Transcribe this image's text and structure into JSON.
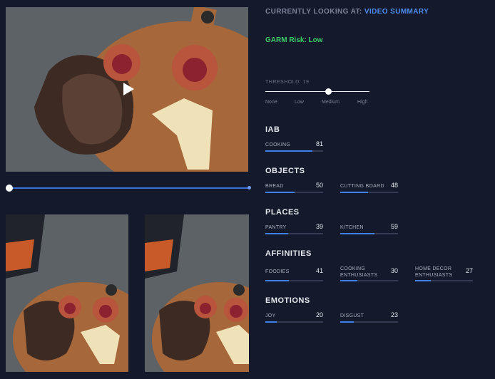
{
  "header": {
    "looking_prefix": "CURRENTLY LOOKING AT:",
    "looking_value": "VIDEO SUMMARY",
    "garm": "GARM Risk: Low"
  },
  "threshold": {
    "label": "THRESHOLD: 19",
    "options": [
      "None",
      "Low",
      "Medium",
      "High"
    ],
    "selected": "Medium"
  },
  "timeline": {
    "position": 0
  },
  "sections": {
    "iab": {
      "title": "IAB",
      "items": [
        {
          "label": "COOKING",
          "value": "81",
          "fraction": 0.81
        }
      ]
    },
    "objects": {
      "title": "OBJECTS",
      "items": [
        {
          "label": "BREAD",
          "value": "50",
          "fraction": 0.5
        },
        {
          "label": "CUTTING BOARD",
          "value": "48",
          "fraction": 0.48
        }
      ]
    },
    "places": {
      "title": "PLACES",
      "items": [
        {
          "label": "PANTRY",
          "value": "39",
          "fraction": 0.39
        },
        {
          "label": "KITCHEN",
          "value": "59",
          "fraction": 0.59
        }
      ]
    },
    "affinities": {
      "title": "AFFINITIES",
      "items": [
        {
          "label": "FOODIES",
          "value": "41",
          "fraction": 0.41
        },
        {
          "label": "COOKING ENTHUSIASTS",
          "value": "30",
          "fraction": 0.3
        },
        {
          "label": "HOME DECOR ENTHUSIASTS",
          "value": "27",
          "fraction": 0.27
        }
      ]
    },
    "emotions": {
      "title": "EMOTIONS",
      "items": [
        {
          "label": "JOY",
          "value": "20",
          "fraction": 0.2
        },
        {
          "label": "DISGUST",
          "value": "23",
          "fraction": 0.23
        }
      ]
    }
  },
  "colors": {
    "background": "#141a2b",
    "accent": "#3f80ea",
    "garm_low": "#3dcc68"
  },
  "icons": {
    "play": "play-icon"
  }
}
